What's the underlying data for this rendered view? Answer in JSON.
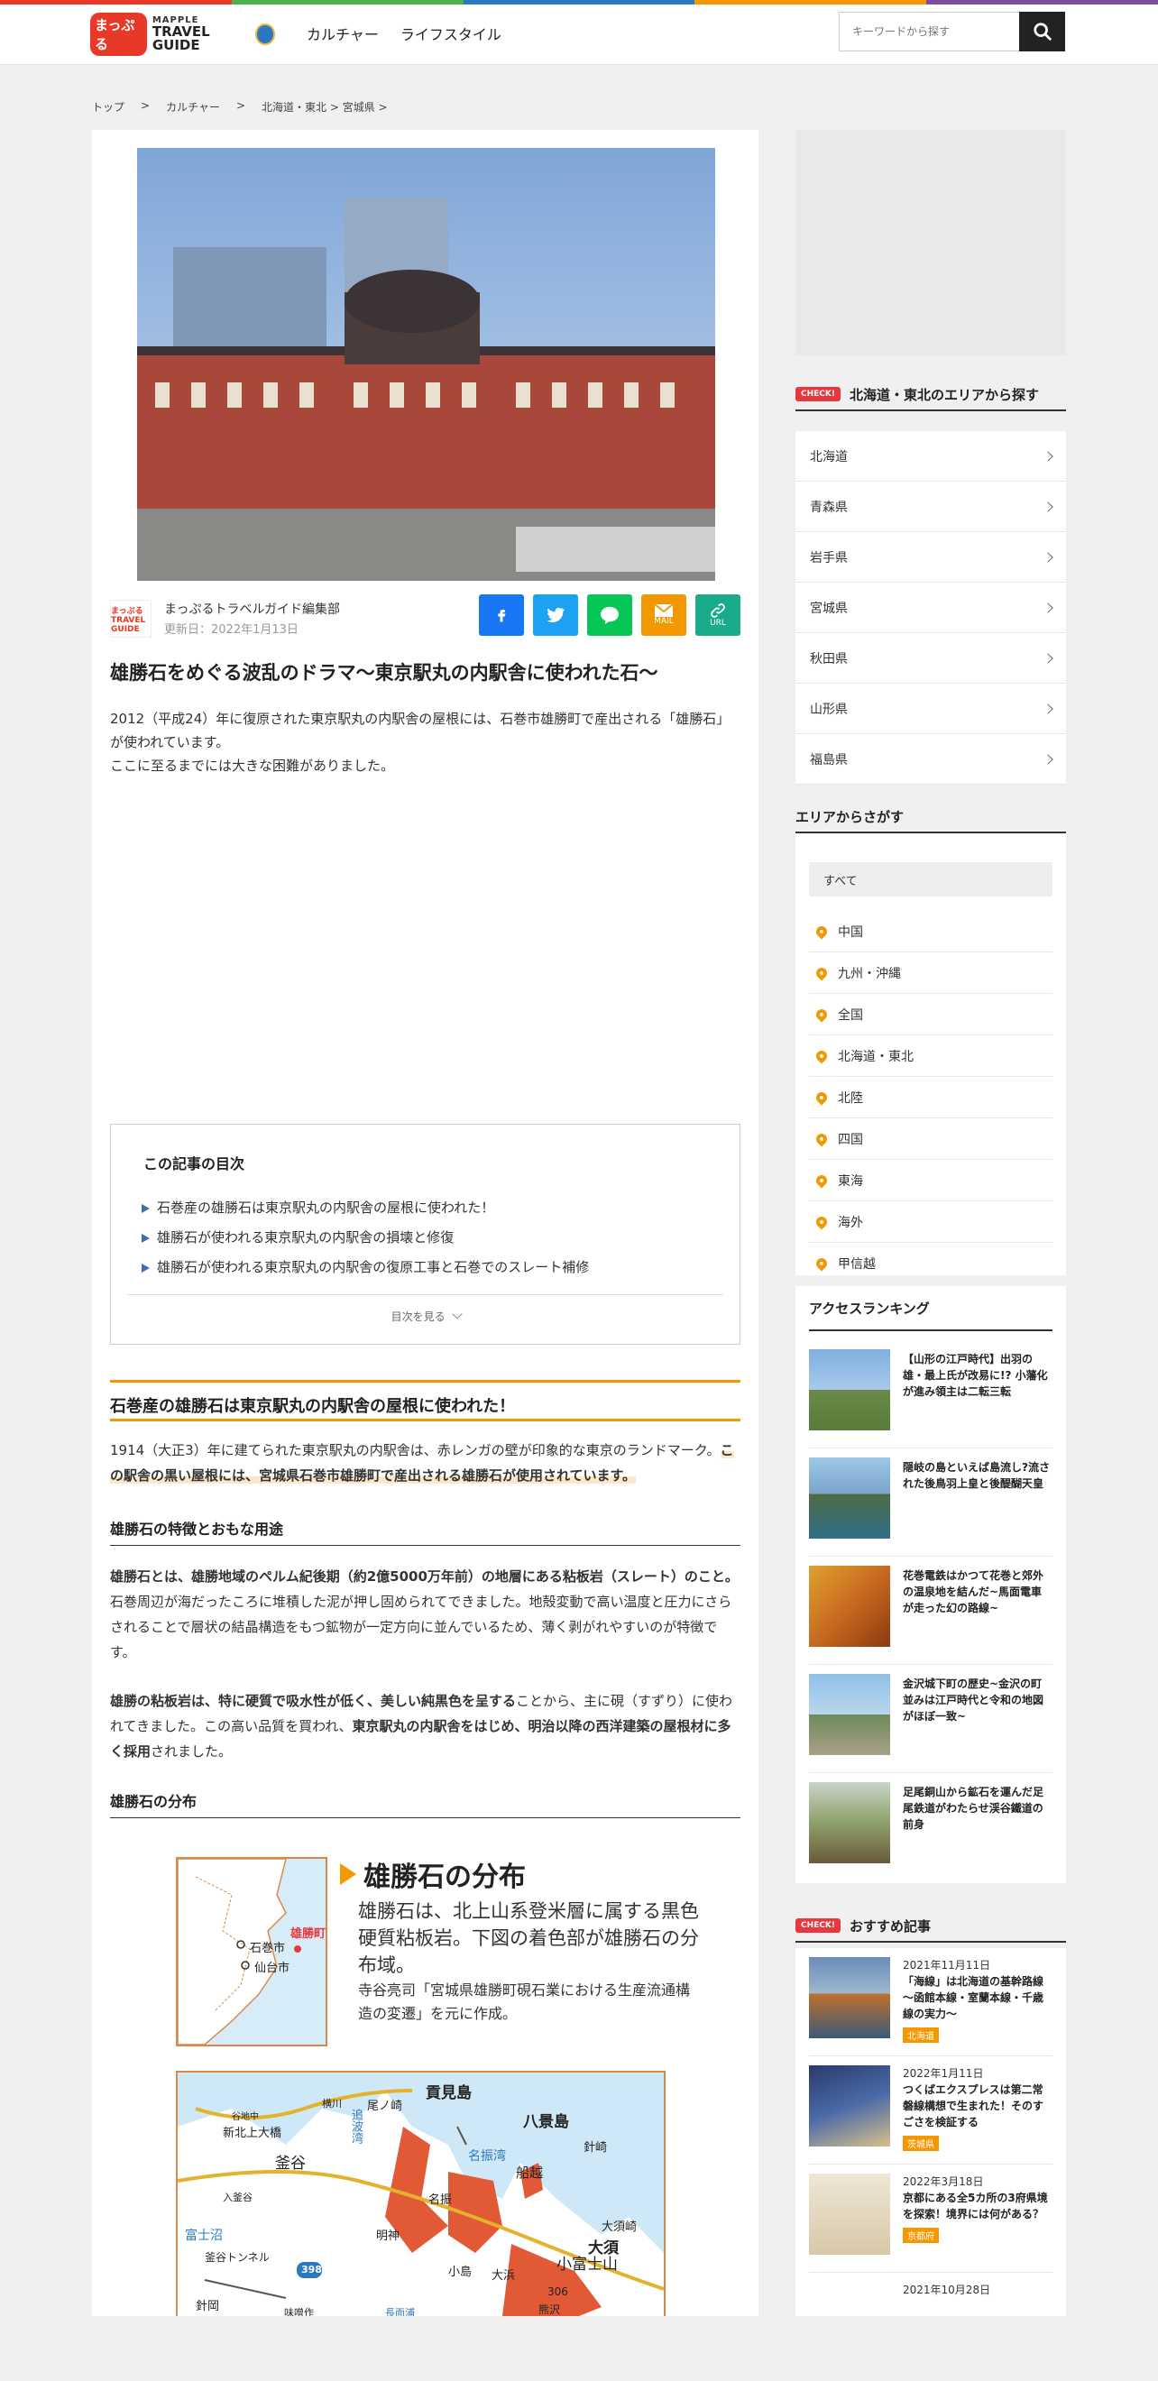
{
  "colors": {
    "accent": "#f39800",
    "check": "#e8383d",
    "facebook": "#1877f2",
    "twitter": "#1da1f2",
    "line": "#06c755",
    "mail": "#f39800",
    "url": "#1aab8a"
  },
  "header": {
    "logo_badge": "まっぷる",
    "logo_top": "MAPPLE",
    "logo_bottom": "TRAVEL GUIDE",
    "nav": [
      "カルチャー",
      "ライフスタイル"
    ],
    "search_placeholder": "キーワードから探す"
  },
  "breadcrumb": [
    "トップ",
    ">",
    "カルチャー",
    ">",
    "北海道・東北 > 宮城県 >"
  ],
  "article": {
    "author": "まっぷるトラベルガイド編集部",
    "author_logo": "まっぷる TRAVEL GUIDE",
    "updated": "更新日：2022年1月13日",
    "share": {
      "mail": "MAIL",
      "url": "URL"
    },
    "title": "雄勝石をめぐる波乱のドラマ～東京駅丸の内駅舎に使われた石～",
    "lead1": "2012（平成24）年に復原された東京駅丸の内駅舎の屋根には、石巻市雄勝町で産出される「雄勝石」が使われています。",
    "lead2": "ここに至るまでには大きな困難がありました。",
    "toc": {
      "heading": "この記事の目次",
      "items": [
        "石巻産の雄勝石は東京駅丸の内駅舎の屋根に使われた！",
        "雄勝石が使われる東京駅丸の内駅舎の損壊と修復",
        "雄勝石が使われる東京駅丸の内駅舎の復原工事と石巻でのスレート補修"
      ],
      "more": "目次を見る"
    },
    "h2": "石巻産の雄勝石は東京駅丸の内駅舎の屋根に使われた！",
    "p1a": "1914（大正3）年に建てられた東京駅丸の内駅舎は、赤レンガの壁が印象的な東京のランドマーク。",
    "p1b": "この駅舎の黒い屋根には、宮城県石巻市雄勝町で産出される雄勝石が使用されています。",
    "h3a": "雄勝石の特徴とおもな用途",
    "p2a": "雄勝石とは、雄勝地域のペルム紀後期（約2億5000万年前）の地層にある粘板岩（スレート）のこと。",
    "p2b": "石巻周辺が海だったころに堆積した泥が押し固められてできました。地殻変動で高い温度と圧力にさらされることで層状の結晶構造をもつ鉱物が一定方向に並んでいるため、薄く剥がれやすいのが特徴です。",
    "p3a": "雄勝の粘板岩は、特に硬質で吸水性が低く、美しい純黒色を呈する",
    "p3b": "ことから、主に硯（すずり）に使われてきました。この高い品質を買われ、",
    "p3c": "東京駅丸の内駅舎をはじめ、明治以降の西洋建築の屋根材に多く採用",
    "p3d": "されました。",
    "h3b": "雄勝石の分布",
    "figure": {
      "title": "雄勝石の分布",
      "desc": "雄勝石は、北上山系登米層に属する黒色硬質粘板岩。下図の着色部が雄勝石の分布域。",
      "source": "寺谷亮司「宮城県雄勝町硯石業における生産流通構造の変遷」を元に作成。",
      "inset_labels": [
        "雄勝町",
        "石巻市",
        "仙台市"
      ],
      "map_labels": [
        "貢見島",
        "八景島",
        "尾ノ崎",
        "追波湾",
        "横川",
        "谷地中",
        "新北上大橋",
        "釜谷",
        "名振湾",
        "船越",
        "針崎",
        "名振",
        "明神",
        "大須崎",
        "大須",
        "小島",
        "大浜",
        "小富士山",
        "熊沢",
        "306",
        "入釜谷",
        "富士沼",
        "釜谷トンネル",
        "398",
        "針岡",
        "味噌作",
        "長面浦"
      ]
    }
  },
  "sidebar": {
    "check": "CHECK!",
    "pref_heading": "北海道・東北のエリアから探す",
    "prefs": [
      "北海道",
      "青森県",
      "岩手県",
      "宮城県",
      "秋田県",
      "山形県",
      "福島県"
    ],
    "area_heading": "エリアからさがす",
    "area_all": "すべて",
    "areas": [
      "中国",
      "九州・沖縄",
      "全国",
      "北海道・東北",
      "北陸",
      "四国",
      "東海",
      "海外",
      "甲信越"
    ],
    "ranking_heading": "アクセスランキング",
    "ranking": [
      "【山形の江戸時代】出羽の雄・最上氏が改易に!? 小藩化が進み領主は二転三転",
      "隠岐の島といえば島流し?流された後鳥羽上皇と後醍醐天皇",
      "花巻電鉄はかつて花巻と郊外の温泉地を結んだ~馬面電車が走った幻の路線~",
      "金沢城下町の歴史~金沢の町並みは江戸時代と令和の地図がほぼ一致~",
      "足尾銅山から鉱石を運んだ足尾鉄道がわたらせ渓谷鐵道の前身"
    ],
    "rec_heading": "おすすめ記事",
    "recs": [
      {
        "date": "2021年11月11日",
        "title": "「海線」は北海道の基幹路線～函館本線・室蘭本線・千歳線の実力～",
        "tag": "北海道"
      },
      {
        "date": "2022年1月11日",
        "title": "つくばエクスプレスは第二常磐線構想で生まれた！そのすごさを検証する",
        "tag": "茨城県"
      },
      {
        "date": "2022年3月18日",
        "title": "京都にある全5カ所の3府県境を探索！境界には何がある？",
        "tag": "京都府"
      },
      {
        "date": "2021年10月28日"
      }
    ]
  }
}
